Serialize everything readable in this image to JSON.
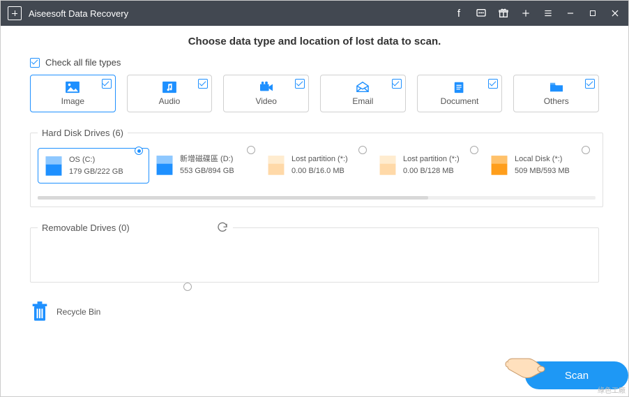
{
  "titlebar": {
    "title": "Aiseesoft Data Recovery"
  },
  "heading": "Choose data type and location of lost data to scan.",
  "check_all_label": "Check all file types",
  "types": {
    "image": "Image",
    "audio": "Audio",
    "video": "Video",
    "email": "Email",
    "document": "Document",
    "others": "Others"
  },
  "sections": {
    "hdd_legend": "Hard Disk Drives (6)",
    "removable_legend": "Removable Drives (0)"
  },
  "drives": [
    {
      "name": "OS (C:)",
      "size": "179 GB/222 GB",
      "color": "#1e90ff",
      "selected": true
    },
    {
      "name": "新增磁碟區 (D:)",
      "size": "553 GB/894 GB",
      "color": "#1e90ff",
      "selected": false
    },
    {
      "name": "Lost partition (*:)",
      "size": "0.00  B/16.0 MB",
      "color": "#ffd9a8",
      "selected": false
    },
    {
      "name": "Lost partition (*:)",
      "size": "0.00  B/128 MB",
      "color": "#ffd9a8",
      "selected": false
    },
    {
      "name": "Local Disk (*:)",
      "size": "509 MB/593 MB",
      "color": "#ff9e1b",
      "selected": false
    }
  ],
  "recycle_label": "Recycle Bin",
  "scan_label": "Scan",
  "watermark": "綠色工廠"
}
